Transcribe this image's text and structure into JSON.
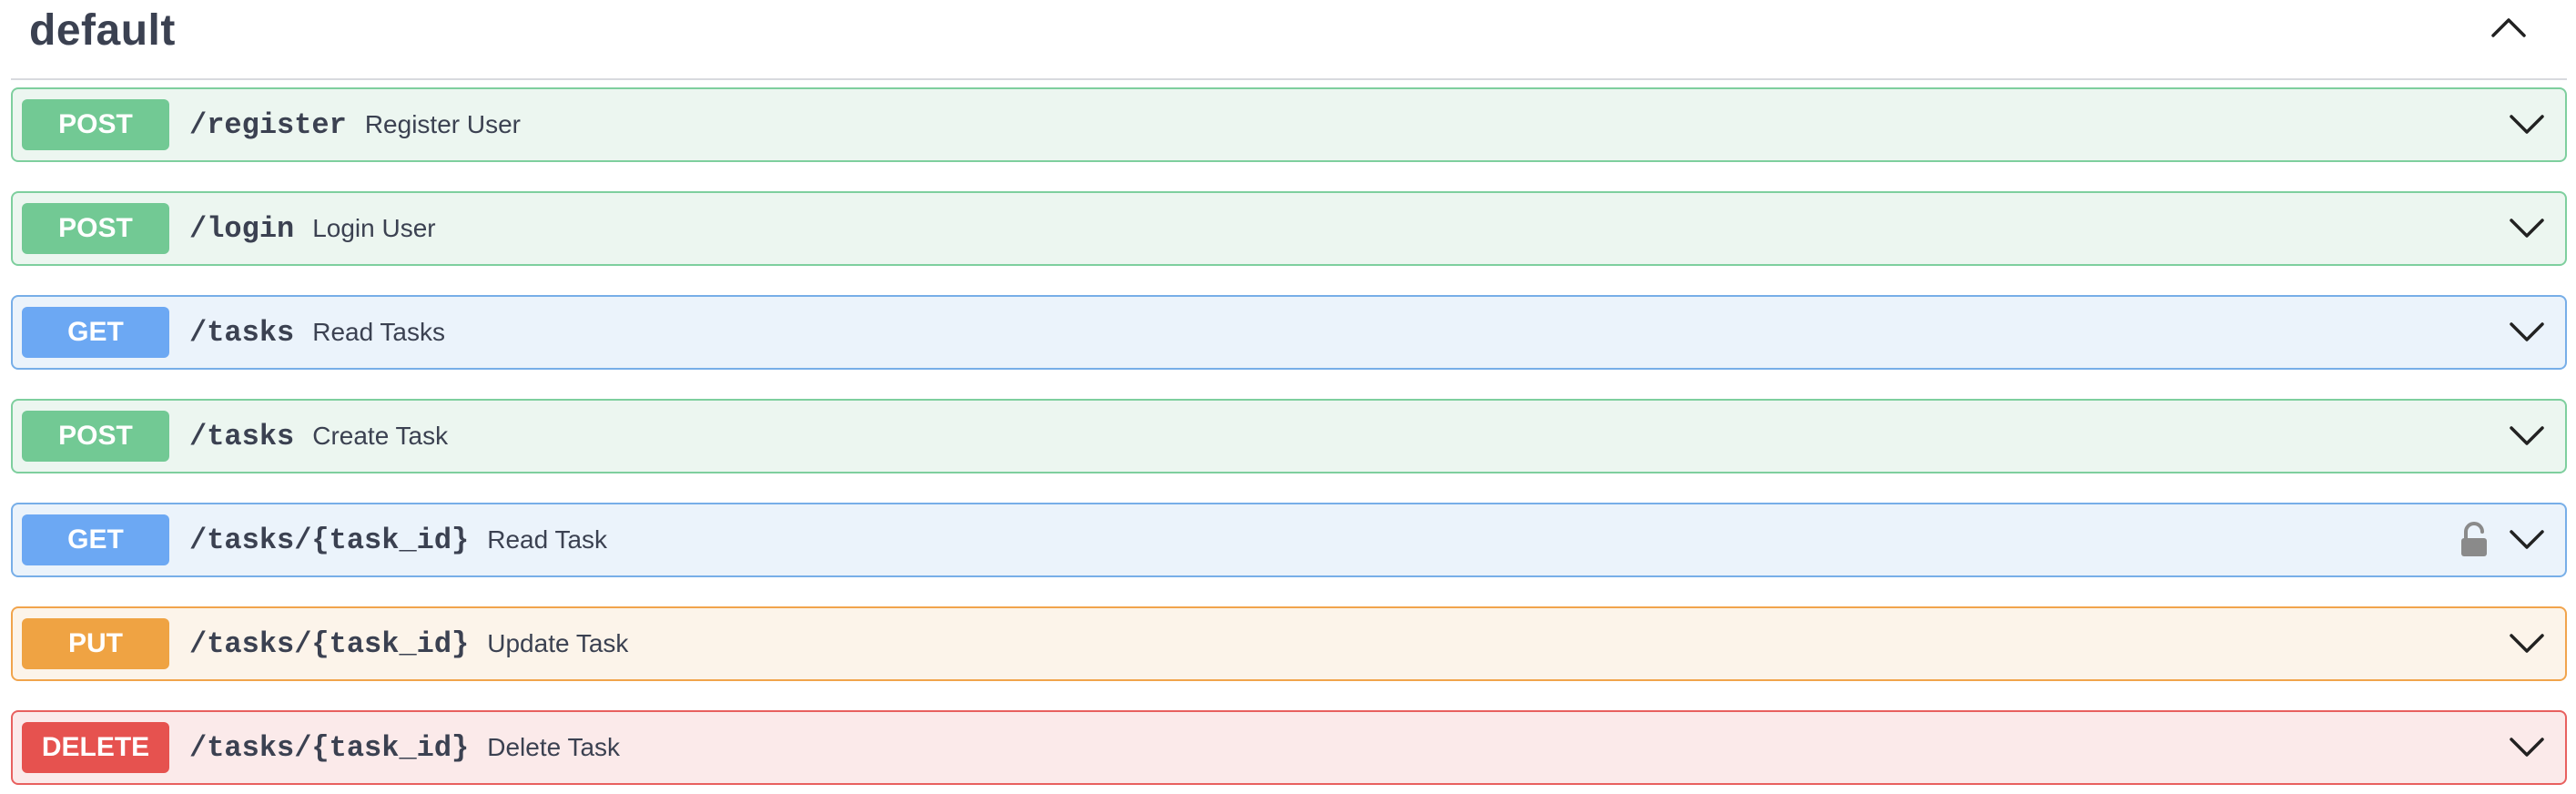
{
  "section": {
    "title": "default",
    "toggle_icon": "chevron-up-icon"
  },
  "colors": {
    "post": "#72c994",
    "get": "#6ca8f3",
    "put": "#efa343",
    "delete": "#e6524f"
  },
  "operations": [
    {
      "method": "POST",
      "path": "/register",
      "summary": "Register User",
      "locked": false,
      "expand_icon": "chevron-down-icon"
    },
    {
      "method": "POST",
      "path": "/login",
      "summary": "Login User",
      "locked": false,
      "expand_icon": "chevron-down-icon"
    },
    {
      "method": "GET",
      "path": "/tasks",
      "summary": "Read Tasks",
      "locked": false,
      "expand_icon": "chevron-down-icon"
    },
    {
      "method": "POST",
      "path": "/tasks",
      "summary": "Create Task",
      "locked": false,
      "expand_icon": "chevron-down-icon"
    },
    {
      "method": "GET",
      "path": "/tasks/{task_id}",
      "summary": "Read Task",
      "locked": true,
      "lock_icon": "unlocked-padlock-icon",
      "expand_icon": "chevron-down-icon"
    },
    {
      "method": "PUT",
      "path": "/tasks/{task_id}",
      "summary": "Update Task",
      "locked": false,
      "expand_icon": "chevron-down-icon"
    },
    {
      "method": "DELETE",
      "path": "/tasks/{task_id}",
      "summary": "Delete Task",
      "locked": false,
      "expand_icon": "chevron-down-icon"
    }
  ]
}
